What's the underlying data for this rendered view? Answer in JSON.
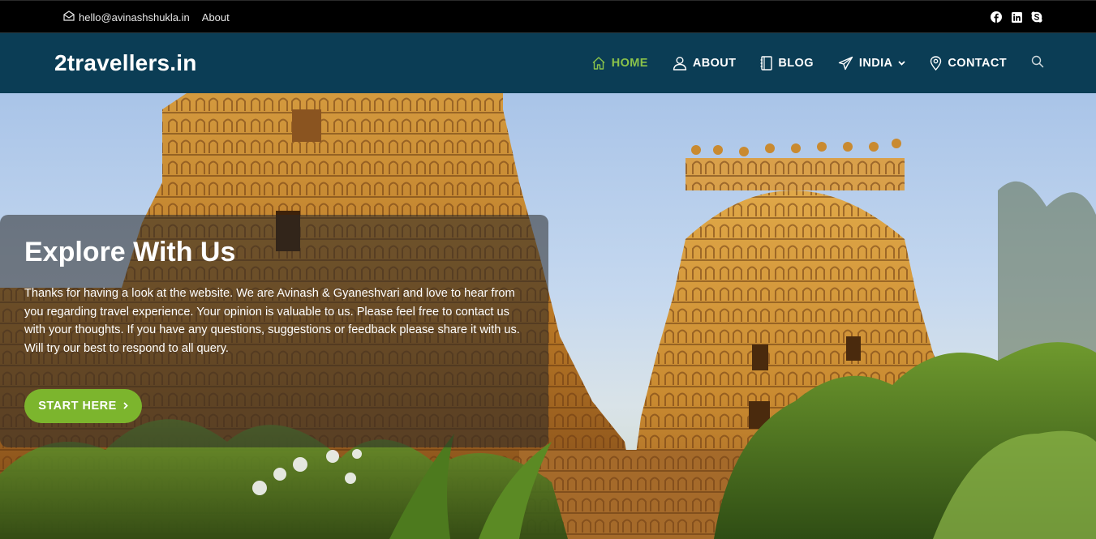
{
  "topbar": {
    "email": "hello@avinashshukla.in",
    "about": "About",
    "social": [
      {
        "name": "facebook-icon"
      },
      {
        "name": "linkedin-icon"
      },
      {
        "name": "skype-icon"
      }
    ]
  },
  "header": {
    "logo": "2travellers.in",
    "nav": {
      "home": "HOME",
      "about": "ABOUT",
      "blog": "BLOG",
      "india": "INDIA",
      "contact": "CONTACT"
    }
  },
  "hero": {
    "title": "Explore With Us",
    "body": "Thanks for having a look at the website. We are Avinash & Gyaneshvari and love to hear from you regarding travel experience. Your opinion is valuable to us. Please feel free to contact us with your thoughts. If you have any questions, suggestions or feedback please share it with us. Will try our best to respond to all query.",
    "cta": "START HERE"
  },
  "colors": {
    "topbar_bg": "#000000",
    "header_bg": "#0b3d55",
    "accent": "#8bc34a",
    "cta_bg": "#7cb52d"
  }
}
